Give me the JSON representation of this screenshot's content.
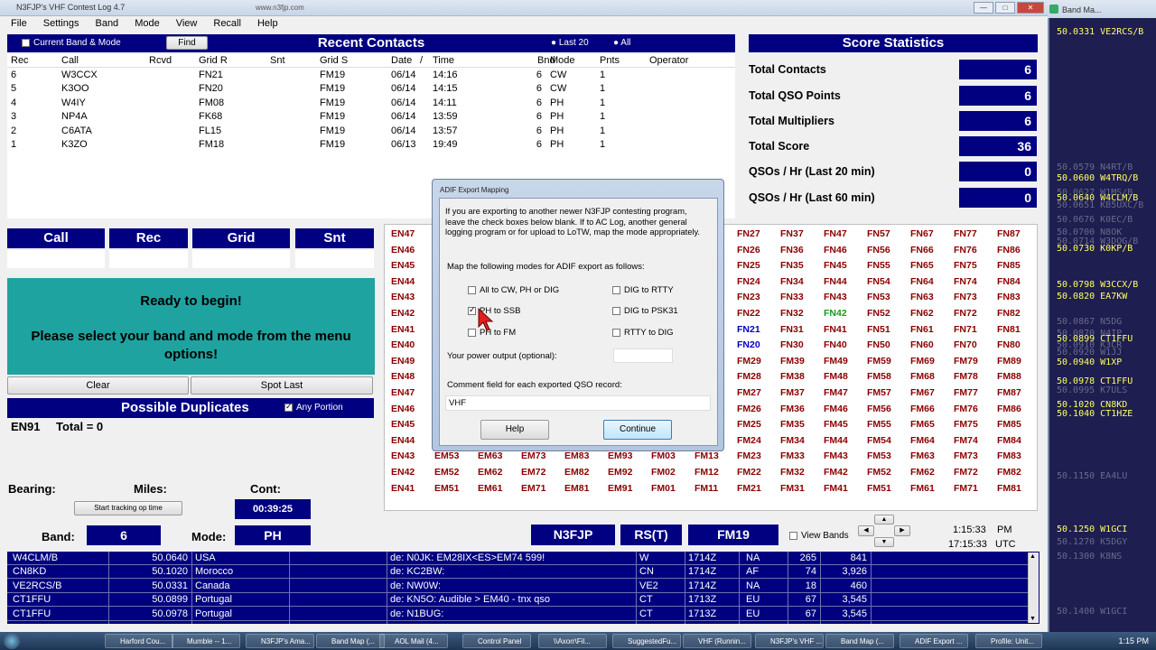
{
  "app": {
    "title": "N3FJP's VHF Contest Log 4.7",
    "url": "www.n3fjp.com",
    "min": "—",
    "max": "□",
    "close": "✕"
  },
  "menu": [
    "File",
    "Settings",
    "Band",
    "Mode",
    "View",
    "Recall",
    "Help"
  ],
  "recent": {
    "title": "Recent Contacts",
    "current_band_mode": "Current Band & Mode",
    "find": "Find",
    "last20": "Last 20",
    "all": "All",
    "columns": [
      "Rec",
      "Call",
      "Rcvd",
      "Grid R",
      "Snt",
      "Grid S",
      "Date",
      "/",
      "Time",
      "Bnd",
      "Mode",
      "Pnts",
      "Operator"
    ],
    "rows": [
      {
        "rec": "6",
        "call": "W3CCX",
        "gridr": "FN21",
        "grids": "FM19",
        "date": "06/14",
        "time": "14:16",
        "bnd": "6",
        "mode": "CW",
        "pnts": "1"
      },
      {
        "rec": "5",
        "call": "K3OO",
        "gridr": "FN20",
        "grids": "FM19",
        "date": "06/14",
        "time": "14:15",
        "bnd": "6",
        "mode": "CW",
        "pnts": "1"
      },
      {
        "rec": "4",
        "call": "W4IY",
        "gridr": "FM08",
        "grids": "FM19",
        "date": "06/14",
        "time": "14:11",
        "bnd": "6",
        "mode": "PH",
        "pnts": "1"
      },
      {
        "rec": "3",
        "call": "NP4A",
        "gridr": "FK68",
        "grids": "FM19",
        "date": "06/14",
        "time": "13:59",
        "bnd": "6",
        "mode": "PH",
        "pnts": "1"
      },
      {
        "rec": "2",
        "call": "C6ATA",
        "gridr": "FL15",
        "grids": "FM19",
        "date": "06/14",
        "time": "13:57",
        "bnd": "6",
        "mode": "PH",
        "pnts": "1"
      },
      {
        "rec": "1",
        "call": "K3ZO",
        "gridr": "FM18",
        "grids": "FM19",
        "date": "06/13",
        "time": "19:49",
        "bnd": "6",
        "mode": "PH",
        "pnts": "1"
      }
    ]
  },
  "score": {
    "title": "Score Statistics",
    "rows": [
      {
        "label": "Total Contacts",
        "value": "6"
      },
      {
        "label": "Total QSO Points",
        "value": "6"
      },
      {
        "label": "Total Multipliers",
        "value": "6"
      },
      {
        "label": "Total Score",
        "value": "36"
      },
      {
        "label": "QSOs / Hr (Last 20 min)",
        "value": "0"
      },
      {
        "label": "QSOs / Hr (Last 60 min)",
        "value": "0"
      }
    ]
  },
  "entry": {
    "call": "Call",
    "rec": "Rec",
    "grid": "Grid",
    "snt": "Snt"
  },
  "ready": {
    "line1": "Ready to begin!",
    "line2": "Please select your band and mode from the menu options!"
  },
  "buttons": {
    "clear": "Clear",
    "spot_last": "Spot Last",
    "start_tracking": "Start tracking op time",
    "view_bands": "View Bands"
  },
  "dups": {
    "title": "Possible Duplicates",
    "any_portion": "Any Portion",
    "grid": "EN91",
    "total": "Total = 0"
  },
  "status": {
    "bearing": "Bearing:",
    "miles": "Miles:",
    "cont": "Cont:",
    "timer": "00:39:25",
    "band_label": "Band:",
    "band": "6",
    "mode_label": "Mode:",
    "mode": "PH",
    "call": "N3FJP",
    "rst": "RS(T)",
    "grid": "FM19",
    "local_time": "1:15:33",
    "local_ampm": "PM",
    "utc_time": "17:15:33",
    "utc": "UTC"
  },
  "grid_cols": {
    "left": [
      "EN47",
      "EN46",
      "EN45",
      "EN44",
      "EN43",
      "EN42",
      "EN41",
      "EN40",
      "EN49",
      "EN48",
      "EN47",
      "EN46",
      "EN45",
      "EN44",
      "EN43",
      "EN42",
      "EN41"
    ],
    "right": [
      [
        "FN27",
        "FN37",
        "FN47",
        "FN57",
        "FN67",
        "FN77",
        "FN87"
      ],
      [
        "FN26",
        "FN36",
        "FN46",
        "FN56",
        "FN66",
        "FN76",
        "FN86"
      ],
      [
        "FN25",
        "FN35",
        "FN45",
        "FN55",
        "FN65",
        "FN75",
        "FN85"
      ],
      [
        "FN24",
        "FN34",
        "FN44",
        "FN54",
        "FN64",
        "FN74",
        "FN84"
      ],
      [
        "FN23",
        "FN33",
        "FN43",
        "FN53",
        "FN63",
        "FN73",
        "FN83"
      ],
      [
        "FN22",
        "FN32",
        "FN42",
        "FN52",
        "FN62",
        "FN72",
        "FN82"
      ],
      [
        "FN21",
        "FN31",
        "FN41",
        "FN51",
        "FN61",
        "FN71",
        "FN81"
      ],
      [
        "FN20",
        "FN30",
        "FN40",
        "FN50",
        "FN60",
        "FN70",
        "FN80"
      ],
      [
        "FM29",
        "FM39",
        "FM49",
        "FM59",
        "FM69",
        "FM79",
        "FM89"
      ],
      [
        "FM28",
        "FM38",
        "FM48",
        "FM58",
        "FM68",
        "FM78",
        "FM88"
      ],
      [
        "FM27",
        "FM37",
        "FM47",
        "FM57",
        "FM67",
        "FM77",
        "FM87"
      ],
      [
        "FM26",
        "FM36",
        "FM46",
        "FM56",
        "FM66",
        "FM76",
        "FM86"
      ],
      [
        "FM25",
        "FM35",
        "FM45",
        "FM55",
        "FM65",
        "FM75",
        "FM85"
      ],
      [
        "FM24",
        "FM34",
        "FM44",
        "FM54",
        "FM64",
        "FM74",
        "FM84"
      ],
      [
        "FM23",
        "FM33",
        "FM43",
        "FM53",
        "FM63",
        "FM73",
        "FM83"
      ],
      [
        "FM22",
        "FM32",
        "FM42",
        "FM52",
        "FM62",
        "FM72",
        "FM82"
      ],
      [
        "FM21",
        "FM31",
        "FM41",
        "FM51",
        "FM61",
        "FM71",
        "FM81"
      ]
    ],
    "bottom_mid": [
      [
        "EM53",
        "EM63",
        "EM73",
        "EM83",
        "EM93",
        "FM03",
        "FM13"
      ],
      [
        "EM52",
        "EM62",
        "EM72",
        "EM82",
        "EM92",
        "FM02",
        "FM12"
      ],
      [
        "EM51",
        "EM61",
        "EM71",
        "EM81",
        "EM91",
        "FM01",
        "FM11"
      ]
    ],
    "colors": {
      "default": "#8b0000",
      "worked_blue": "#0000c0",
      "worked_green": "#1a9a1a"
    }
  },
  "dialog": {
    "title": "ADIF Export Mapping",
    "intro": "If you are exporting to another newer N3FJP contesting program, leave the check  boxes below blank.  If to AC Log, another general logging program or for upload to LoTW, map the mode appropriately.",
    "map_label": "Map the following modes for ADIF export as follows:",
    "opts": [
      "All to CW, PH or DIG",
      "DIG to RTTY",
      "PH to SSB",
      "DIG to PSK31",
      "PH to FM",
      "RTTY to DIG"
    ],
    "power_label": "Your power output (optional):",
    "comment_label": "Comment field for each exported QSO record:",
    "comment_value": "VHF",
    "help": "Help",
    "continue": "Continue"
  },
  "spots": [
    {
      "call": "W4CLM/B",
      "freq": "50.0640",
      "country": "USA",
      "de": "de: N0JK: EM28IX<ES>EM74 599!",
      "dir": "W",
      "time": "1714Z",
      "cont": "NA",
      "n1": "265",
      "n2": "841"
    },
    {
      "call": "CN8KD",
      "freq": "50.1020",
      "country": "Morocco",
      "de": "de: KC2BW:",
      "dir": "CN",
      "time": "1714Z",
      "cont": "AF",
      "n1": "74",
      "n2": "3,926"
    },
    {
      "call": "VE2RCS/B",
      "freq": "50.0331",
      "country": "Canada",
      "de": "de: NW0W:",
      "dir": "VE2",
      "time": "1714Z",
      "cont": "NA",
      "n1": "18",
      "n2": "460"
    },
    {
      "call": "CT1FFU",
      "freq": "50.0899",
      "country": "Portugal",
      "de": "de: KN5O: Audible > EM40 - tnx qso",
      "dir": "CT",
      "time": "1713Z",
      "cont": "EU",
      "n1": "67",
      "n2": "3,545"
    },
    {
      "call": "CT1FFU",
      "freq": "50.0978",
      "country": "Portugal",
      "de": "de: N1BUG:",
      "dir": "CT",
      "time": "1713Z",
      "cont": "EU",
      "n1": "67",
      "n2": "3,545"
    }
  ],
  "bandmap": {
    "title": "Band Ma...",
    "entries": [
      {
        "t": "50.0331 VE2RCS/B",
        "c": "#ffff66"
      },
      {
        "t": "50.0579 N4RT/B",
        "c": "#6a6a8a"
      },
      {
        "t": "50.0600 W4TRQ/B",
        "c": "#ffff66"
      },
      {
        "t": "50.0627 W1MS/B",
        "c": "#6a6a8a"
      },
      {
        "t": "50.0640 W4CLM/B",
        "c": "#ffff66"
      },
      {
        "t": "50.0651 KB5UXC/B",
        "c": "#6a6a8a"
      },
      {
        "t": "50.0676 K0EC/B",
        "c": "#6a6a8a"
      },
      {
        "t": "50.0700 N8OK",
        "c": "#6a6a8a"
      },
      {
        "t": "50.0714 W3DOG/B",
        "c": "#6a6a8a"
      },
      {
        "t": "50.0730 K0KP/B",
        "c": "#ffff66"
      },
      {
        "t": "50.0798 W3CCX/B",
        "c": "#ffff66"
      },
      {
        "t": "50.0820 EA7KW",
        "c": "#ffff66"
      },
      {
        "t": "50.0867 N5DG",
        "c": "#6a6a8a"
      },
      {
        "t": "50.0870 N4IP",
        "c": "#6a6a8a"
      },
      {
        "t": "50.0899 CT1FFU",
        "c": "#ffff66"
      },
      {
        "t": "50.0910 K3CR",
        "c": "#6a6a8a"
      },
      {
        "t": "50.0920 W1JJ",
        "c": "#6a6a8a"
      },
      {
        "t": "50.0940 W1XP",
        "c": "#ffff66"
      },
      {
        "t": "50.0978 CT1FFU",
        "c": "#ffff66"
      },
      {
        "t": "50.0995 K7ULS",
        "c": "#6a6a8a"
      },
      {
        "t": "50.1020 CN8KD",
        "c": "#ffff66"
      },
      {
        "t": "50.1040 CT1HZE",
        "c": "#ffff66"
      },
      {
        "t": "50.1150 EA4LU",
        "c": "#6a6a8a"
      },
      {
        "t": "50.1250 W1GCI",
        "c": "#ffff66"
      },
      {
        "t": "50.1270 K5DGY",
        "c": "#6a6a8a"
      },
      {
        "t": "50.1300 K8NS",
        "c": "#6a6a8a"
      },
      {
        "t": "50.1400 W1GCI",
        "c": "#6a6a8a"
      }
    ]
  },
  "taskbar": {
    "items": [
      "Harford Cou...",
      "Mumble -- 1...",
      "N3FJP's Ama...",
      "Band Map (...",
      "AOL Mail (4...",
      "Control Panel",
      "\\\\Axorr\\Fil...",
      "SuggestedFu...",
      "VHF (Runnin...",
      "N3FJP's VHF ...",
      "Band Map (...",
      "ADIF Export ...",
      "Profile: Unit..."
    ],
    "clock": "1:15 PM"
  }
}
